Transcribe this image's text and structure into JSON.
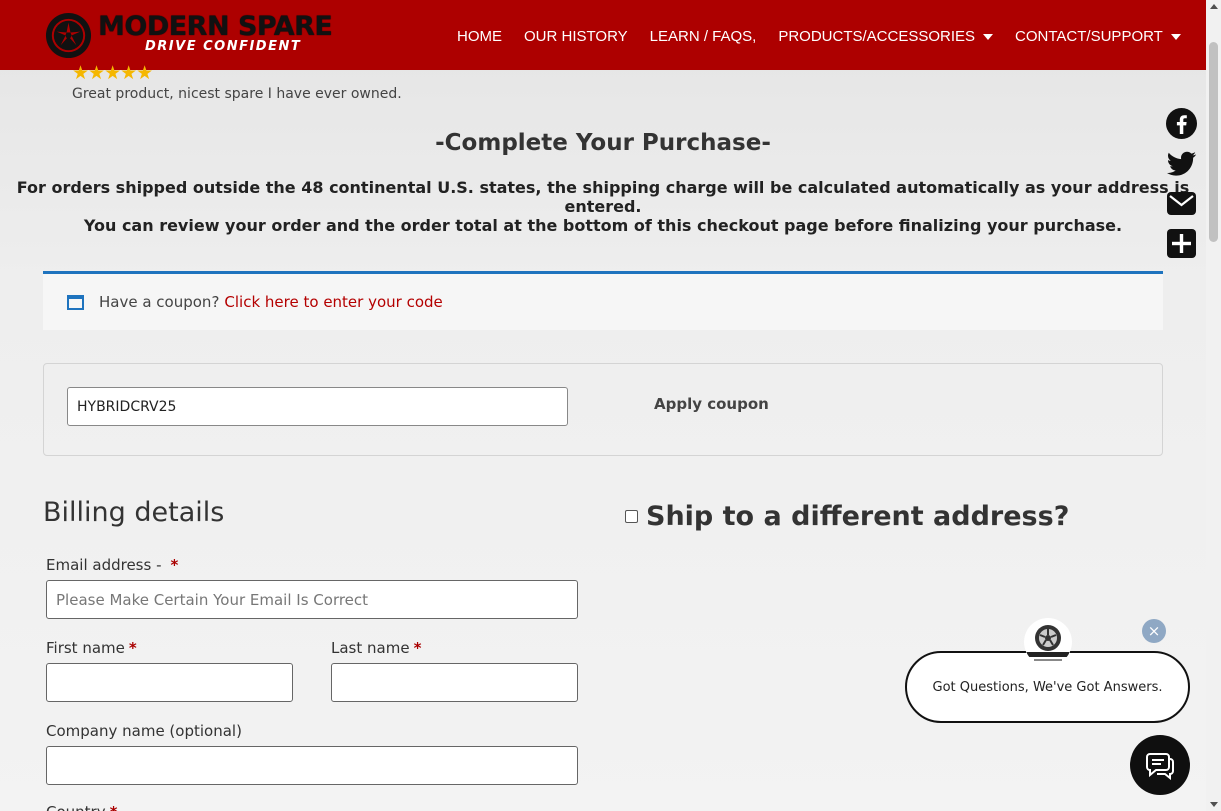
{
  "header": {
    "brand_name": "MODERN SPARE",
    "brand_tagline": "DRIVE CONFIDENT",
    "nav": [
      {
        "label": "HOME",
        "dropdown": false
      },
      {
        "label": "OUR HISTORY",
        "dropdown": false
      },
      {
        "label": "LEARN / FAQS,",
        "dropdown": false
      },
      {
        "label": "PRODUCTS/ACCESSORIES",
        "dropdown": true
      },
      {
        "label": "CONTACT/SUPPORT",
        "dropdown": true
      }
    ],
    "bg_color": "#ad0000"
  },
  "review": {
    "stars": "★★★★★",
    "text": "Great product, nicest spare I have ever owned."
  },
  "checkout": {
    "headline": "-Complete Your Purchase-",
    "notice_1": "For orders shipped outside the 48 continental U.S. states, the shipping charge will be calculated automatically as your address is entered.",
    "notice_2": "You can review your order and the order total at the bottom of this checkout page before finalizing your purchase."
  },
  "coupon": {
    "question": "Have a coupon?",
    "link": "Click here to enter your code",
    "code_value": "HYBRIDCRV25",
    "apply_label": "Apply coupon",
    "accent": "#1e73be"
  },
  "billing": {
    "title": "Billing details",
    "ship_label": "Ship to a different address?",
    "email_label": "Email address -",
    "email_placeholder": "Please Make Certain Your Email Is Correct",
    "first_label": "First name",
    "last_label": "Last name",
    "company_label": "Company name (optional)",
    "country_label": "Country",
    "required_mark": "*"
  },
  "share": {
    "icons": [
      "facebook-icon",
      "twitter-icon",
      "email-icon",
      "plus-icon"
    ]
  },
  "chat": {
    "message": "Got Questions, We've Got Answers.",
    "close": "×"
  }
}
